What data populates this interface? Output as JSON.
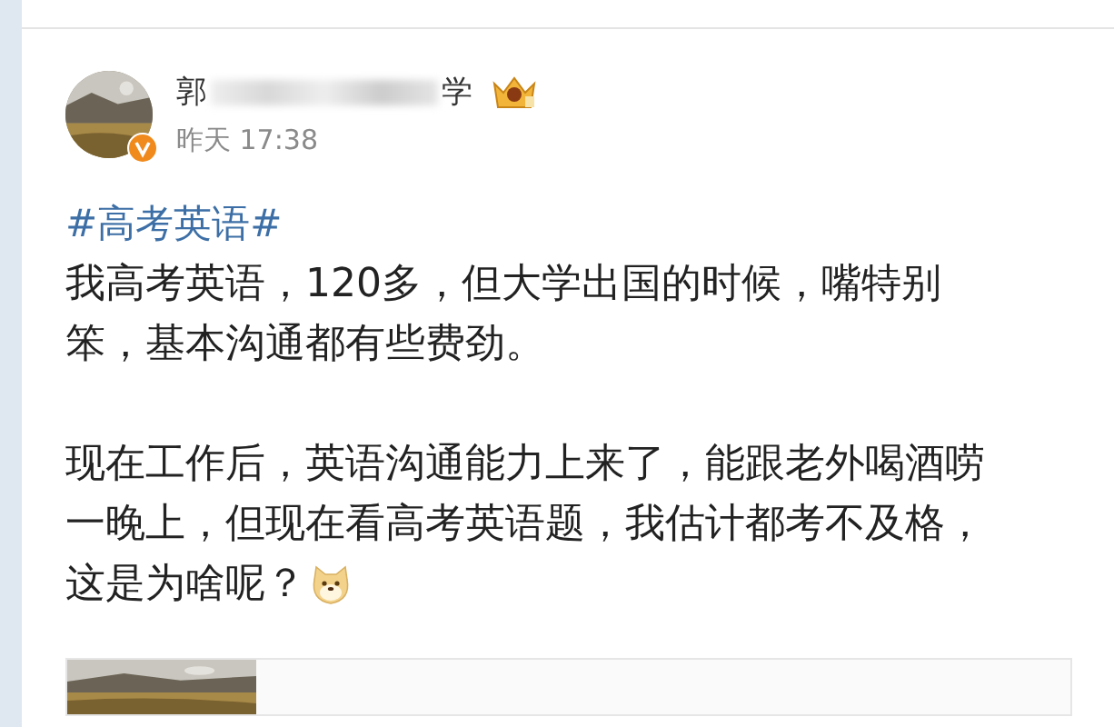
{
  "post": {
    "author": {
      "name_start": "郭",
      "name_end": "学"
    },
    "time": "昨天 17:38",
    "hashtag": "#高考英语#",
    "paragraphs": [
      [
        "我高考英语，120多，但大学出国的时候，嘴特别",
        "笨，基本沟通都有些费劲。"
      ],
      [
        "现在工作后，英语沟通能力上来了，能跟老外喝酒唠",
        "一晚上，但现在看高考英语题，我估计都考不及格，",
        "这是为啥呢？"
      ]
    ],
    "attachment": {
      "kind": "picture"
    }
  }
}
